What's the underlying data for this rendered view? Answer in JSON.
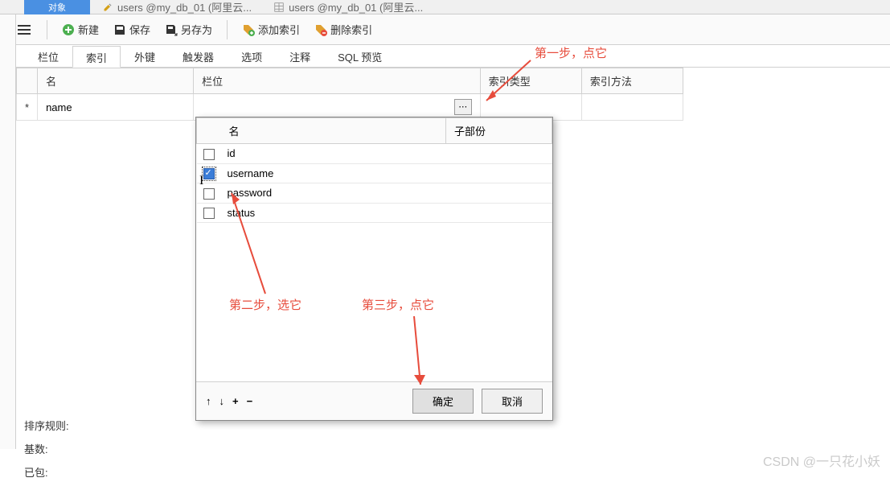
{
  "titleRow": {
    "activeTab": "对象",
    "tabs": [
      "users @my_db_01 (阿里云...",
      "users @my_db_01 (阿里云..."
    ]
  },
  "toolbar": {
    "newLabel": "新建",
    "saveLabel": "保存",
    "saveAsLabel": "另存为",
    "addIndexLabel": "添加索引",
    "deleteIndexLabel": "删除索引"
  },
  "subtabs": [
    "栏位",
    "索引",
    "外键",
    "触发器",
    "选项",
    "注释",
    "SQL 预览"
  ],
  "activeSubtab": "索引",
  "indexTable": {
    "headers": {
      "name": "名",
      "field": "栏位",
      "type": "索引类型",
      "method": "索引方法"
    },
    "rows": [
      {
        "marker": "*",
        "name": "name",
        "field": "",
        "type": "",
        "method": ""
      }
    ]
  },
  "popup": {
    "headers": {
      "name": "名",
      "subpart": "子部份"
    },
    "rows": [
      {
        "checked": false,
        "name": "id"
      },
      {
        "checked": true,
        "name": "username"
      },
      {
        "checked": false,
        "name": "password"
      },
      {
        "checked": false,
        "name": "status"
      }
    ],
    "footer": {
      "ok": "确定",
      "cancel": "取消"
    }
  },
  "annotations": {
    "step1": "第一步，点它",
    "step2": "第二步，选它",
    "step3": "第三步，点它"
  },
  "bottomProps": {
    "sortRule": "排序规则:",
    "cardinality": "基数:",
    "packed": "已包:"
  },
  "watermark": "CSDN @一只花小妖"
}
